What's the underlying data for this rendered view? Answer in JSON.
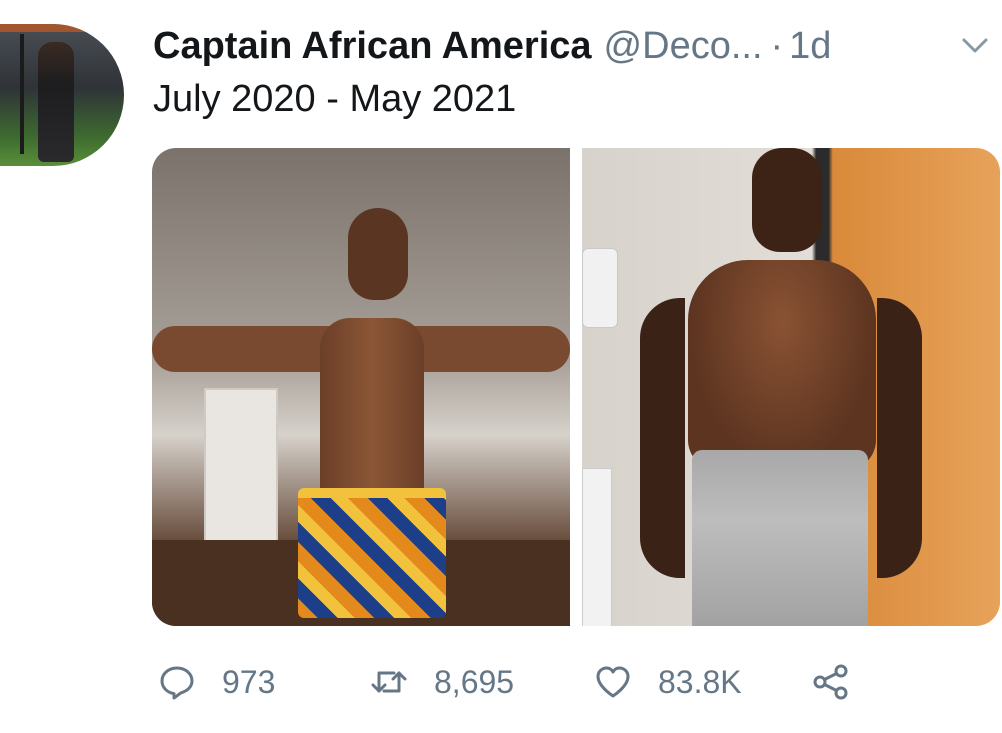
{
  "tweet": {
    "author_name": "Captain African America",
    "handle": "@Deco...",
    "separator": "·",
    "time": "1d",
    "text": "July 2020 - May 2021"
  },
  "icons": {
    "menu": "chevron-down-icon",
    "reply": "reply-icon",
    "retweet": "retweet-icon",
    "like": "heart-icon",
    "share": "share-icon"
  },
  "stats": {
    "replies": "973",
    "retweets": "8,695",
    "likes": "83.8K"
  },
  "colors": {
    "text_primary": "#14171a",
    "text_secondary": "#657786",
    "background": "#ffffff"
  }
}
